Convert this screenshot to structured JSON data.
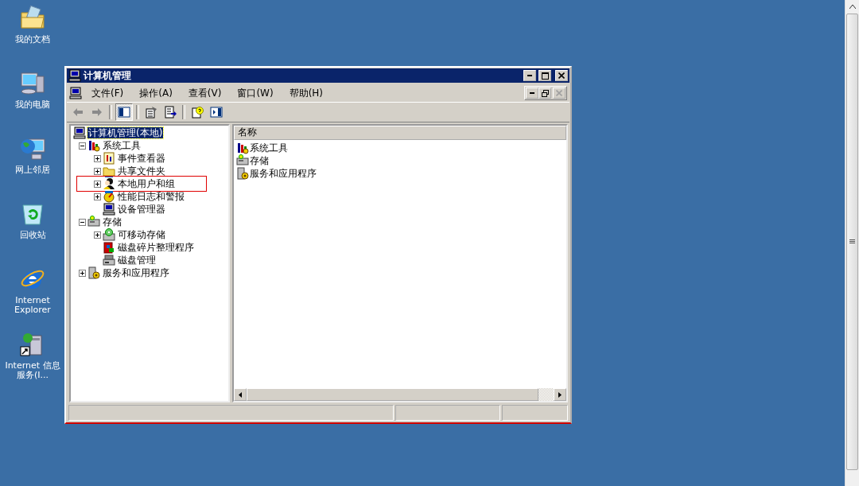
{
  "desktop": {
    "icons": [
      {
        "kind": "folder",
        "label": "我的文档"
      },
      {
        "kind": "computer",
        "label": "我的电脑"
      },
      {
        "kind": "network",
        "label": "网上邻居"
      },
      {
        "kind": "recycle",
        "label": "回收站"
      },
      {
        "kind": "browser",
        "label": "Internet Explorer"
      },
      {
        "kind": "shortcut",
        "label": "Internet 信息服务(I..."
      }
    ]
  },
  "window": {
    "title": "计算机管理",
    "menu": [
      "文件(F)",
      "操作(A)",
      "查看(V)",
      "窗口(W)",
      "帮助(H)"
    ],
    "toolbar": [
      {
        "kind": "back",
        "disabled": true,
        "pressed": false
      },
      {
        "kind": "forward",
        "disabled": true,
        "pressed": false
      },
      {
        "kind": "separator"
      },
      {
        "kind": "tree-toggle",
        "disabled": false,
        "pressed": true
      },
      {
        "kind": "separator"
      },
      {
        "kind": "properties",
        "disabled": false,
        "pressed": false
      },
      {
        "kind": "export",
        "disabled": false,
        "pressed": false
      },
      {
        "kind": "separator"
      },
      {
        "kind": "help",
        "disabled": false,
        "pressed": false
      },
      {
        "kind": "pane-toggle",
        "disabled": false,
        "pressed": false
      }
    ],
    "tree": {
      "label": "计算机管理(本地)",
      "kind": "computer",
      "selected": true,
      "highlighted": false,
      "children": [
        {
          "label": "系统工具",
          "kind": "tools",
          "selected": false,
          "highlighted": false,
          "expanded": true,
          "children": [
            {
              "label": "事件查看器",
              "kind": "events",
              "selected": false,
              "highlighted": false,
              "expanded": false
            },
            {
              "label": "共享文件夹",
              "kind": "share",
              "selected": false,
              "highlighted": false,
              "expanded": false
            },
            {
              "label": "本地用户和组",
              "kind": "users",
              "selected": false,
              "highlighted": true,
              "expanded": false
            },
            {
              "label": "性能日志和警报",
              "kind": "perf",
              "selected": false,
              "highlighted": false,
              "expanded": false
            },
            {
              "label": "设备管理器",
              "kind": "computer",
              "selected": false,
              "highlighted": false
            }
          ]
        },
        {
          "label": "存储",
          "kind": "storage",
          "selected": false,
          "highlighted": false,
          "expanded": true,
          "children": [
            {
              "label": "可移动存储",
              "kind": "removable",
              "selected": false,
              "highlighted": false,
              "expanded": false
            },
            {
              "label": "磁盘碎片整理程序",
              "kind": "defrag",
              "selected": false,
              "highlighted": false
            },
            {
              "label": "磁盘管理",
              "kind": "disk",
              "selected": false,
              "highlighted": false
            }
          ]
        },
        {
          "label": "服务和应用程序",
          "kind": "services",
          "selected": false,
          "highlighted": false,
          "expanded": false
        }
      ]
    },
    "list": {
      "columns": [
        "名称"
      ],
      "rows": [
        {
          "label": "系统工具",
          "kind": "tools"
        },
        {
          "label": "存储",
          "kind": "storage"
        },
        {
          "label": "服务和应用程序",
          "kind": "services"
        }
      ]
    }
  }
}
